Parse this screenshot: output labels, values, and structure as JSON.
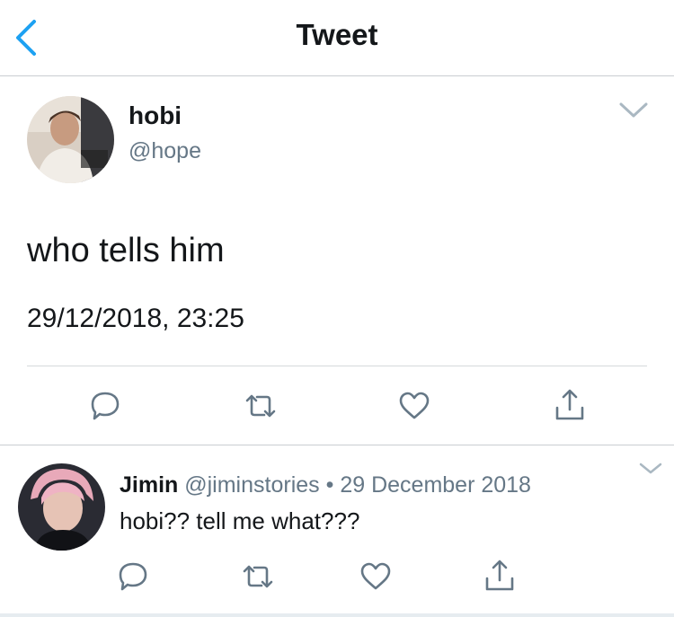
{
  "header": {
    "title": "Tweet"
  },
  "colors": {
    "accent": "#1da1f2",
    "text": "#14171a",
    "secondary": "#657786",
    "divider": "#c9cdd1"
  },
  "tweet": {
    "author_name": "hobi",
    "author_handle": "@hope",
    "text": "who tells him",
    "timestamp": "29/12/2018, 23:25",
    "actions": [
      "reply-icon",
      "retweet-icon",
      "like-icon",
      "share-icon"
    ]
  },
  "reply": {
    "author_name": "Jimin",
    "author_handle": "@jiminstories",
    "separator": "•",
    "date": "29 December 2018",
    "text": "hobi?? tell me what???",
    "actions": [
      "reply-icon",
      "retweet-icon",
      "like-icon",
      "share-icon"
    ]
  }
}
